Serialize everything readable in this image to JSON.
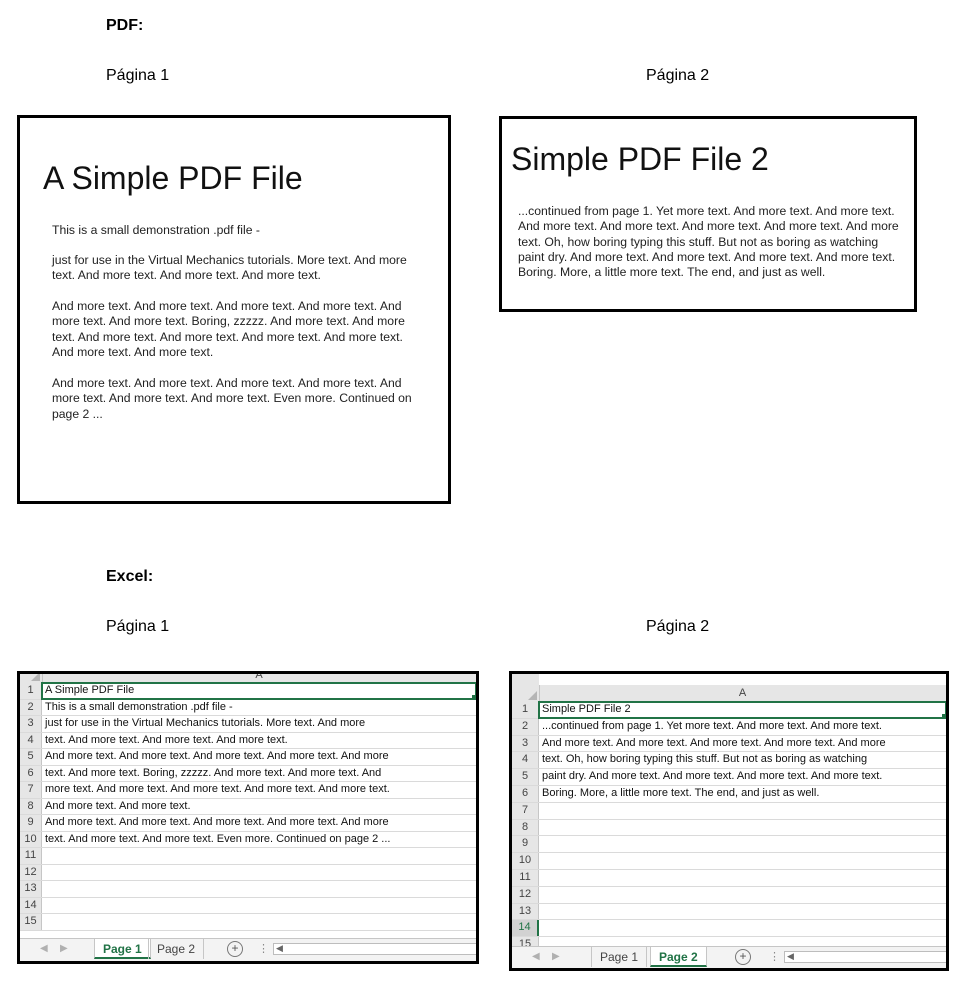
{
  "pdf_section": {
    "heading": "PDF:",
    "page1": {
      "label": "Página 1",
      "title": "A Simple PDF File",
      "paragraphs": [
        "This is a small demonstration .pdf file -",
        "just for use in the Virtual Mechanics tutorials. More text. And more text. And more text. And more text. And more text.",
        "And more text. And more text. And more text. And more text. And more text. And more text. Boring, zzzzz. And more text. And more text. And more text. And more text. And more text. And more text. And more text. And more text.",
        "And more text. And more text. And more text. And more text. And more text. And more text. And more text. Even more. Continued on page 2 ..."
      ]
    },
    "page2": {
      "label": "Página 2",
      "title": "Simple PDF File 2",
      "paragraphs": [
        "...continued from page 1. Yet more text. And more text. And more text. And more text. And more text. And more text. And more text. And more text. Oh, how boring typing this stuff. But not as boring as watching paint dry. And more text. And more text. And more text. And more text. Boring.  More, a little more text. The end, and just as well."
      ]
    }
  },
  "excel_section": {
    "heading": "Excel:",
    "page1": {
      "label": "Página 1",
      "column_header": "A",
      "rows": [
        {
          "num": "1",
          "text": "A Simple PDF File"
        },
        {
          "num": "2",
          "text": "This is a small demonstration .pdf file -"
        },
        {
          "num": "3",
          "text": "just for use in the Virtual Mechanics tutorials. More text. And more"
        },
        {
          "num": "4",
          "text": "text. And more text. And more text. And more text."
        },
        {
          "num": "5",
          "text": "And more text. And more text. And more text. And more text. And more"
        },
        {
          "num": "6",
          "text": "text. And more text. Boring, zzzzz. And more text. And more text. And"
        },
        {
          "num": "7",
          "text": "more text. And more text. And more text. And more text. And more text."
        },
        {
          "num": "8",
          "text": "And more text. And more text."
        },
        {
          "num": "9",
          "text": "And more text. And more text. And more text. And more text. And more"
        },
        {
          "num": "10",
          "text": "text. And more text. And more text. Even more. Continued on page 2 ..."
        },
        {
          "num": "11",
          "text": ""
        },
        {
          "num": "12",
          "text": ""
        },
        {
          "num": "13",
          "text": ""
        },
        {
          "num": "14",
          "text": ""
        },
        {
          "num": "15",
          "text": ""
        }
      ],
      "tabs": [
        "Page 1",
        "Page 2"
      ],
      "active_tab": "Page 1",
      "add_sheet_symbol": "+",
      "more_symbol": "⋮"
    },
    "page2": {
      "label": "Página 2",
      "column_header": "A",
      "rows": [
        {
          "num": "1",
          "text": "Simple PDF File 2"
        },
        {
          "num": "2",
          "text": "...continued from page 1. Yet more text. And more text. And more text."
        },
        {
          "num": "3",
          "text": "And more text. And more text. And more text. And more text. And more"
        },
        {
          "num": "4",
          "text": "text. Oh, how boring typing this stuff. But not as boring as watching"
        },
        {
          "num": "5",
          "text": "paint dry. And more text. And more text. And more text. And more text."
        },
        {
          "num": "6",
          "text": "Boring. More, a little more text. The end, and just as well."
        },
        {
          "num": "7",
          "text": ""
        },
        {
          "num": "8",
          "text": ""
        },
        {
          "num": "9",
          "text": ""
        },
        {
          "num": "10",
          "text": ""
        },
        {
          "num": "11",
          "text": ""
        },
        {
          "num": "12",
          "text": ""
        },
        {
          "num": "13",
          "text": ""
        },
        {
          "num": "14",
          "text": ""
        },
        {
          "num": "15",
          "text": ""
        }
      ],
      "active_row": "14",
      "tabs": [
        "Page 1",
        "Page 2"
      ],
      "active_tab": "Page 2",
      "add_sheet_symbol": "+",
      "more_symbol": "⋮"
    }
  },
  "colors": {
    "excel_accent": "#217346",
    "header_gray": "#e6e6e6"
  }
}
